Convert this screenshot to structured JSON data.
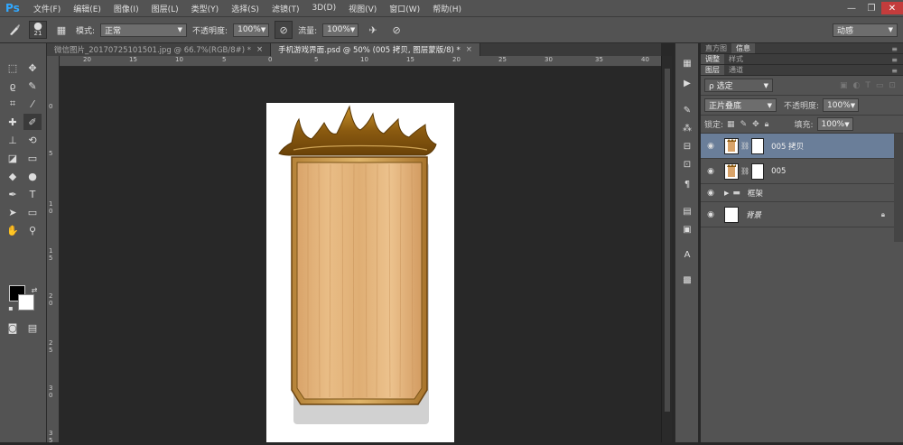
{
  "app": {
    "logo": "Ps",
    "menu": [
      "文件(F)",
      "编辑(E)",
      "图像(I)",
      "图层(L)",
      "类型(Y)",
      "选择(S)",
      "滤镜(T)",
      "3D(D)",
      "视图(V)",
      "窗口(W)",
      "帮助(H)"
    ],
    "window_controls": [
      "—",
      "❐",
      "✕"
    ]
  },
  "options": {
    "brush_size": "21",
    "mode_label": "模式:",
    "mode_value": "正常",
    "opacity_label": "不透明度:",
    "opacity_value": "100%",
    "flow_label": "流量:",
    "flow_value": "100%",
    "workspace": "动感"
  },
  "tabs": [
    {
      "label": "微信图片_20170725101501.jpg @ 66.7%(RGB/8#) *",
      "close": "×"
    },
    {
      "label": "手机游戏界面.psd @ 50% (005 拷贝, 图层蒙版/8) *",
      "close": "×"
    }
  ],
  "rulers": {
    "top": [
      "20",
      "15",
      "10",
      "5",
      "0",
      "5",
      "10",
      "15",
      "20",
      "25",
      "30",
      "35",
      "40"
    ],
    "left": [
      "0",
      "5",
      "1 0",
      "1 5",
      "2 0",
      "2 5",
      "3 0",
      "3 5"
    ]
  },
  "panels": {
    "row1_tabs": [
      "直方图",
      "信息"
    ],
    "row2_tabs": [
      "调整",
      "样式"
    ],
    "layers_tabs": [
      "图层",
      "通道"
    ],
    "filter_label": "ρ 选定",
    "blend_mode": "正片叠底",
    "opacity_label": "不透明度:",
    "opacity_value": "100%",
    "lock_label": "锁定:",
    "fill_label": "填充:",
    "fill_value": "100%",
    "menu_glyph": "≡"
  },
  "layers": [
    {
      "name": "005 拷贝",
      "selected": true
    },
    {
      "name": "005",
      "selected": false
    },
    {
      "name": "框架",
      "selected": false,
      "group": true
    },
    {
      "name": "背景",
      "selected": false,
      "locked": true
    }
  ],
  "colors": {
    "wood_light": "#e3b47b",
    "wood_dark": "#c8925a",
    "frame_gold": "#8a5a10",
    "selection": "#6a7e99"
  }
}
